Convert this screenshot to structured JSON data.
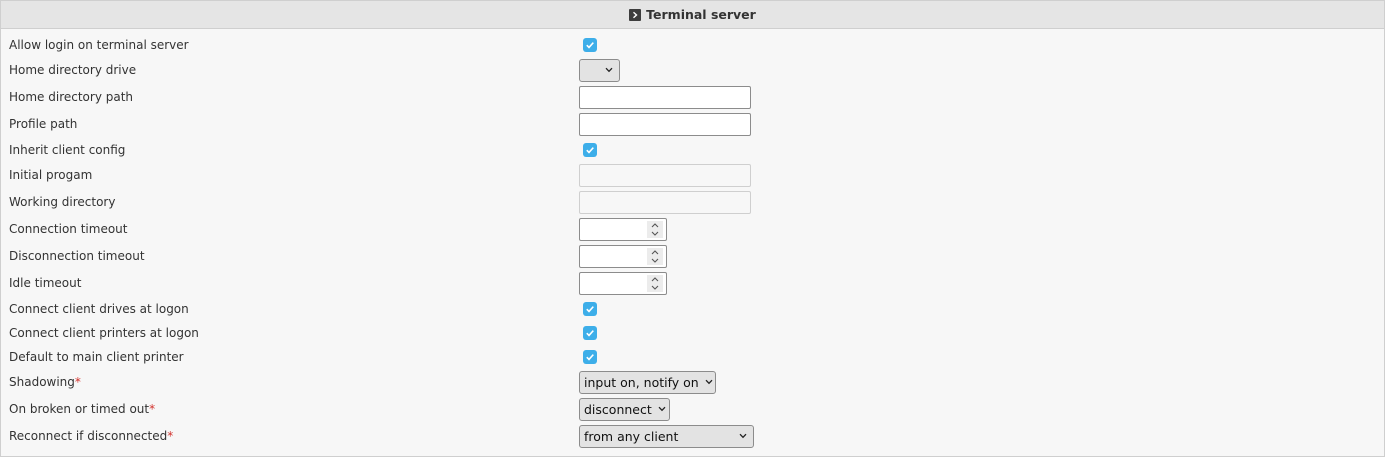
{
  "panel": {
    "title": "Terminal server"
  },
  "fields": {
    "allow_login": {
      "label": "Allow login on terminal server",
      "checked": true
    },
    "home_drive": {
      "label": "Home directory drive",
      "value": ""
    },
    "home_path": {
      "label": "Home directory path",
      "value": "",
      "placeholder": ""
    },
    "profile_path": {
      "label": "Profile path",
      "value": "",
      "placeholder": ""
    },
    "inherit_client_config": {
      "label": "Inherit client config",
      "checked": true
    },
    "initial_program": {
      "label": "Initial progam",
      "value": "",
      "disabled": true
    },
    "working_directory": {
      "label": "Working directory",
      "value": "",
      "disabled": true
    },
    "connection_timeout": {
      "label": "Connection timeout",
      "value": ""
    },
    "disconnection_timeout": {
      "label": "Disconnection timeout",
      "value": ""
    },
    "idle_timeout": {
      "label": "Idle timeout",
      "value": ""
    },
    "connect_client_drives": {
      "label": "Connect client drives at logon",
      "checked": true
    },
    "connect_client_printers": {
      "label": "Connect client printers at logon",
      "checked": true
    },
    "default_main_printer": {
      "label": "Default to main client printer",
      "checked": true
    },
    "shadowing": {
      "label": "Shadowing",
      "required_mark": "*",
      "value": "input on, notify on"
    },
    "on_broken": {
      "label": "On broken or timed out",
      "required_mark": "*",
      "value": "disconnect"
    },
    "reconnect": {
      "label": "Reconnect if disconnected",
      "required_mark": "*",
      "value": "from any client"
    }
  },
  "colors": {
    "checkbox_accent": "#3daee9",
    "required_marker": "#d2322d",
    "panel_header_bg": "#e5e5e5",
    "panel_bg": "#f7f7f7"
  },
  "icons": {
    "panel_toggle": "chevron-right-icon",
    "checkbox": "checkmark-icon",
    "dropdown": "chevron-down-icon",
    "spinner_up": "chevron-up-icon",
    "spinner_down": "chevron-down-icon"
  }
}
